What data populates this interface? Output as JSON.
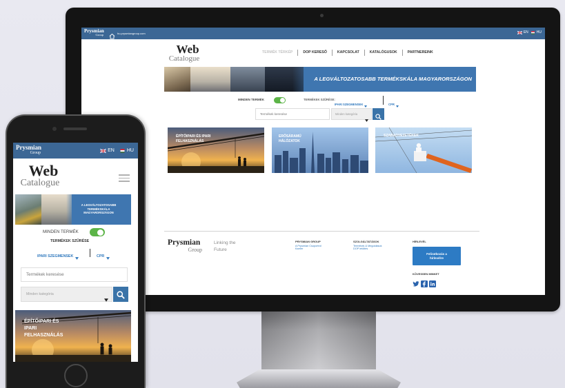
{
  "colors": {
    "brand_blue": "#3c6795",
    "banner_blue": "#3f76b0",
    "link_blue": "#2f78bd",
    "button_blue": "#3a73a8",
    "toggle_green": "#5cb447"
  },
  "desktop": {
    "topbar": {
      "logo_main": "Prysmian",
      "logo_sub": "Group",
      "address": "hu.prysmiangroup.com",
      "lang_en": "EN",
      "lang_hu": "HU"
    },
    "logo": {
      "main": "Web",
      "sub": "Catalogue"
    },
    "nav": [
      "TERMÉK TÉRKÉP",
      "DOP KERESŐ",
      "KAPCSOLAT",
      "KATALÓGUSOK",
      "PARTNEREINK"
    ],
    "banner_text": "A LEGVÁLTOZATOSABB TERMÉKSKÁLA MAGYARORSZÁGON",
    "filters": {
      "all_products": "MINDEN TERMÉK",
      "all_products_on": true,
      "filter_label": "TERMÉKEK SZŰRÉSE:",
      "segments": "IPARI SZEGMENSEK",
      "cpr": "CPR"
    },
    "search": {
      "placeholder": "Termékek keresése",
      "category": "Minden kategória"
    },
    "cards": [
      "ÉPÍTŐIPARI ÉS IPARI FELHASZNÁLÁS",
      "ERŐSÁRAMÚ HÁLÓZATOK",
      "SZABADVEZETÉKEK"
    ],
    "footer": {
      "logo_main": "Prysmian",
      "logo_sub": "Group",
      "tagline": "Linking the Future",
      "col1": {
        "title": "PRYSMIAN GROUP",
        "links": [
          "A Prysmian Csoportról",
          "Karrier"
        ]
      },
      "col2": {
        "title": "SZOLGÁLTATÁSOK",
        "links": [
          "Termékek & Megoldások",
          "DOP letöltés"
        ]
      },
      "newsletter": {
        "title": "HÍRLEVÉL",
        "button": "Feliratkozás a hírlevélre"
      },
      "social": {
        "title": "KÖVESSEN MINKET",
        "icons": [
          "twitter-icon",
          "facebook-icon",
          "linkedin-icon"
        ]
      }
    }
  },
  "mobile": {
    "topbar": {
      "logo_main": "Prysmian",
      "logo_sub": "Group",
      "lang_en": "EN",
      "lang_hu": "HU"
    },
    "logo": {
      "main": "Web",
      "sub": "Catalogue"
    },
    "banner_text": "A LEGVÁLTOZATOSABB TERMÉKSKÁLA MAGYARORSZÁGON",
    "filters": {
      "all_products": "MINDEN TERMÉK",
      "all_products_on": true,
      "filter_label": "TERMÉKEK SZŰRÉSE",
      "segments": "IPARI SZEGMENSEK",
      "cpr": "CPR"
    },
    "search": {
      "placeholder": "Termékek keresése",
      "category": "Minden kategória"
    },
    "card": "ÉPÍTŐIPARI ÉS IPARI FELHASZNÁLÁS"
  }
}
